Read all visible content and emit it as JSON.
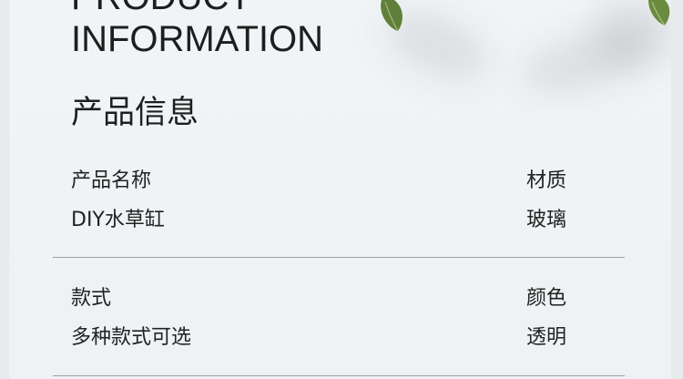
{
  "heading": {
    "english_line1": "PRODUCT",
    "english_line2": "INFORMATION",
    "chinese": "产品信息"
  },
  "rows": [
    {
      "left_label": "产品名称",
      "left_value": "DIY水草缸",
      "right_label": "材质",
      "right_value": "玻璃"
    },
    {
      "left_label": "款式",
      "left_value": "多种款式可选",
      "right_label": "颜色",
      "right_value": "透明"
    }
  ],
  "decor": {
    "leaf_icon": "leaf-icon",
    "leaf_color": "#5f7f3a",
    "card_color": "#eef2f4",
    "divider_color": "#9aa1a6"
  }
}
